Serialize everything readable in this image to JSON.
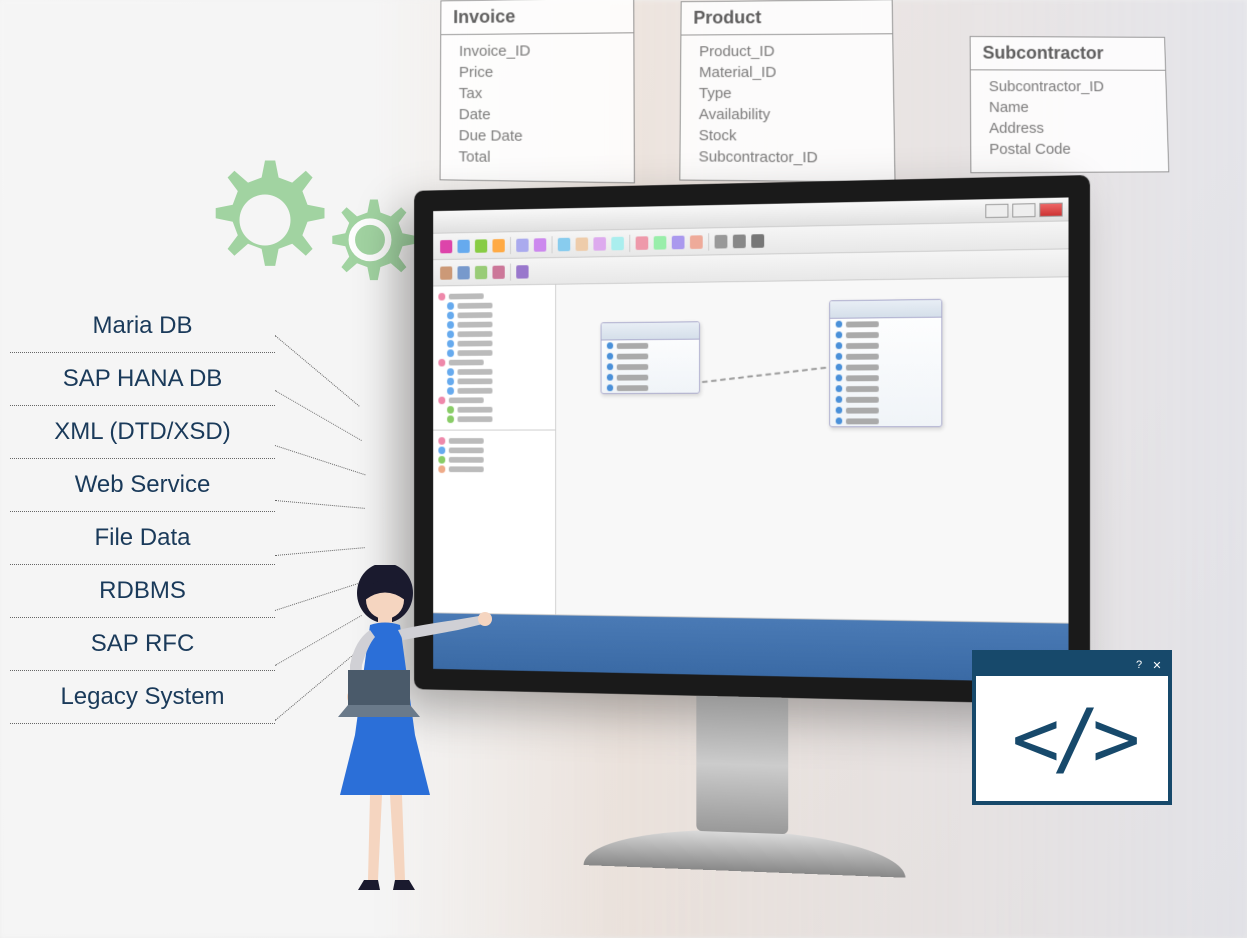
{
  "schemas": {
    "invoice": {
      "title": "Invoice",
      "fields": [
        "Invoice_ID",
        "Price",
        "Tax",
        "Date",
        "Due Date",
        "Total"
      ]
    },
    "product": {
      "title": "Product",
      "fields": [
        "Product_ID",
        "Material_ID",
        "Type",
        "Availability",
        "Stock",
        "Subcontractor_ID"
      ]
    },
    "subcontractor": {
      "title": "Subcontractor",
      "fields": [
        "Subcontractor_ID",
        "Name",
        "Address",
        "Postal Code"
      ]
    }
  },
  "side_list": [
    "Maria DB",
    "SAP HANA DB",
    "XML (DTD/XSD)",
    "Web Service",
    "File Data",
    "RDBMS",
    "SAP RFC",
    "Legacy System"
  ],
  "code_window": {
    "symbol": "</>"
  },
  "colors": {
    "navy": "#17496b",
    "gear_green": "#8dcb8d",
    "person_blue": "#2b6fd8"
  }
}
